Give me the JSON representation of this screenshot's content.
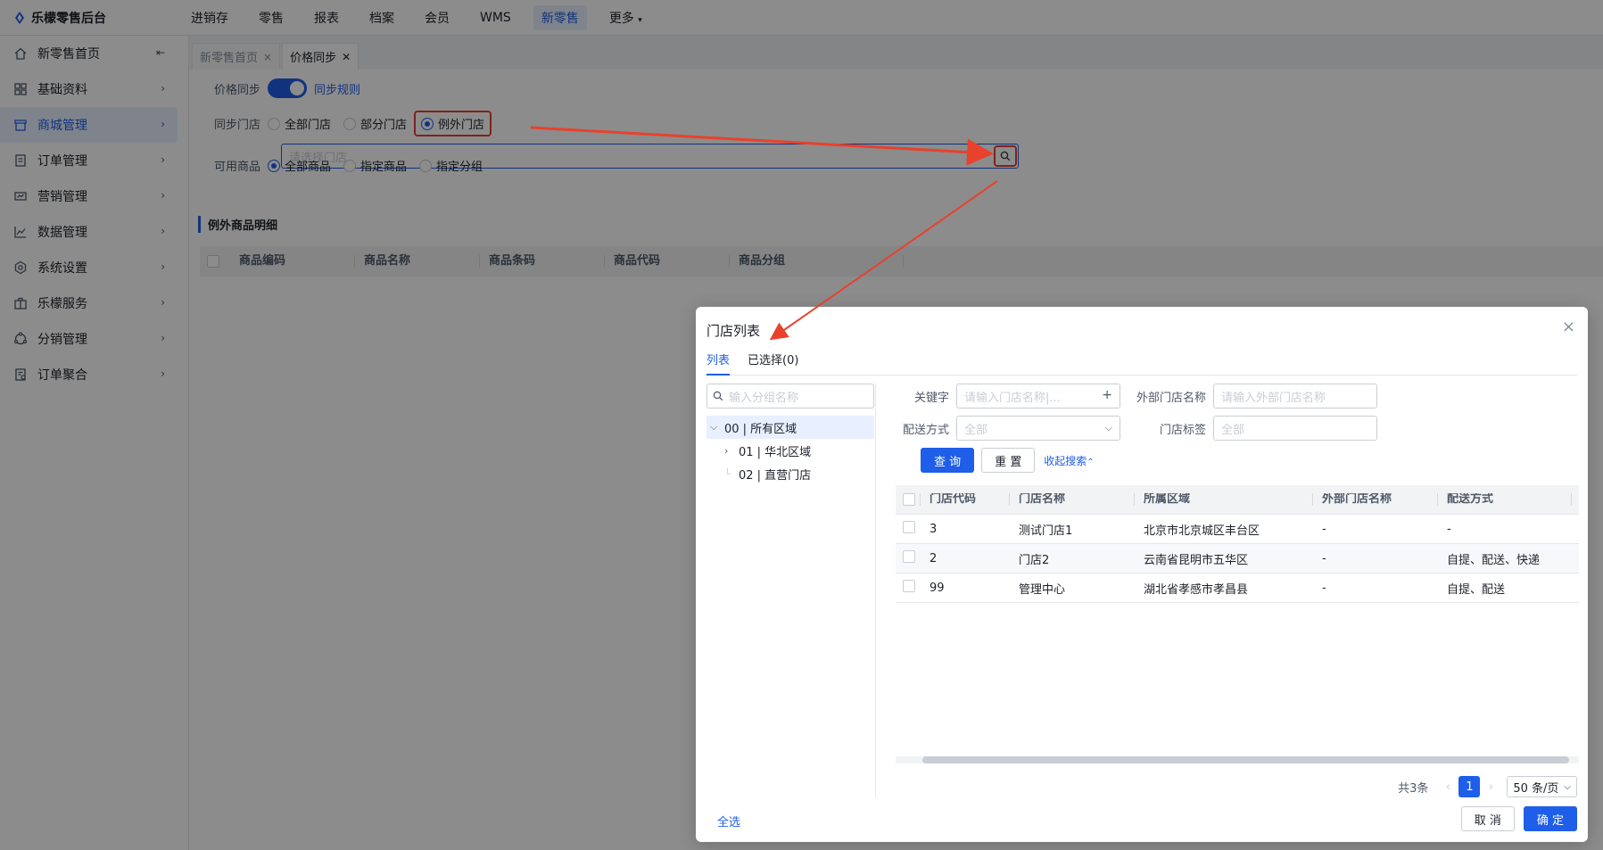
{
  "app": {
    "title": "乐檬零售后台"
  },
  "topnav": [
    "进销存",
    "零售",
    "报表",
    "档案",
    "会员",
    "WMS",
    "新零售",
    "更多"
  ],
  "topnav_active": "新零售",
  "sidebar": {
    "items": [
      {
        "label": "新零售首页",
        "icon": "home-icon"
      },
      {
        "label": "基础资料",
        "icon": "grid-icon"
      },
      {
        "label": "商城管理",
        "icon": "store-icon"
      },
      {
        "label": "订单管理",
        "icon": "order-icon"
      },
      {
        "label": "营销管理",
        "icon": "marketing-icon"
      },
      {
        "label": "数据管理",
        "icon": "chart-icon"
      },
      {
        "label": "系统设置",
        "icon": "gear-icon"
      },
      {
        "label": "乐檬服务",
        "icon": "service-icon"
      },
      {
        "label": "分销管理",
        "icon": "distribution-icon"
      },
      {
        "label": "订单聚合",
        "icon": "aggregate-icon"
      }
    ],
    "active_index": 2
  },
  "tabs": [
    {
      "label": "新零售首页",
      "close": "×"
    },
    {
      "label": "价格同步",
      "close": "✕"
    }
  ],
  "form": {
    "price_sync_label": "价格同步",
    "sync_rule_link": "同步规则",
    "sync_store_label": "同步门店",
    "store_options": [
      "全部门店",
      "部分门店",
      "例外门店"
    ],
    "store_selected": "例外门店",
    "store_placeholder": "请选择门店",
    "goods_label": "可用商品",
    "goods_options": [
      "全部商品",
      "指定商品",
      "指定分组"
    ],
    "goods_selected": "全部商品"
  },
  "exception_section": {
    "title": "例外商品明细",
    "columns": [
      "商品编码",
      "商品名称",
      "商品条码",
      "商品代码",
      "商品分组"
    ]
  },
  "modal": {
    "title": "门店列表",
    "close": "×",
    "tabs": [
      "列表",
      "已选择(0)"
    ],
    "tree_search_placeholder": "输入分组名称",
    "tree": {
      "root": "00 | 所有区域",
      "children": [
        "01 | 华北区域",
        "02 | 直营门店"
      ]
    },
    "filters": {
      "keyword_label": "关键字",
      "keyword_placeholder": "请输入门店名称|...",
      "external_name_label": "外部门店名称",
      "external_name_placeholder": "请输入外部门店名称",
      "delivery_label": "配送方式",
      "delivery_value": "全部",
      "tag_label": "门店标签",
      "tag_value": "全部"
    },
    "buttons": {
      "query": "查 询",
      "reset": "重 置",
      "collapse": "收起搜索",
      "select_all": "全选",
      "cancel": "取 消",
      "confirm": "确 定"
    },
    "table": {
      "columns": [
        "门店代码",
        "门店名称",
        "所属区域",
        "外部门店名称",
        "配送方式"
      ],
      "rows": [
        [
          "3",
          "测试门店1",
          "北京市北京城区丰台区",
          "-",
          "-"
        ],
        [
          "2",
          "门店2",
          "云南省昆明市五华区",
          "-",
          "自提、配送、快递"
        ],
        [
          "99",
          "管理中心",
          "湖北省孝感市孝昌县",
          "-",
          "自提、配送"
        ]
      ]
    },
    "pagination": {
      "total": "共3条",
      "current_page": "1",
      "page_size": "50 条/页"
    }
  },
  "colors": {
    "primary": "#1f5ee8",
    "annotation": "#e8412c"
  }
}
